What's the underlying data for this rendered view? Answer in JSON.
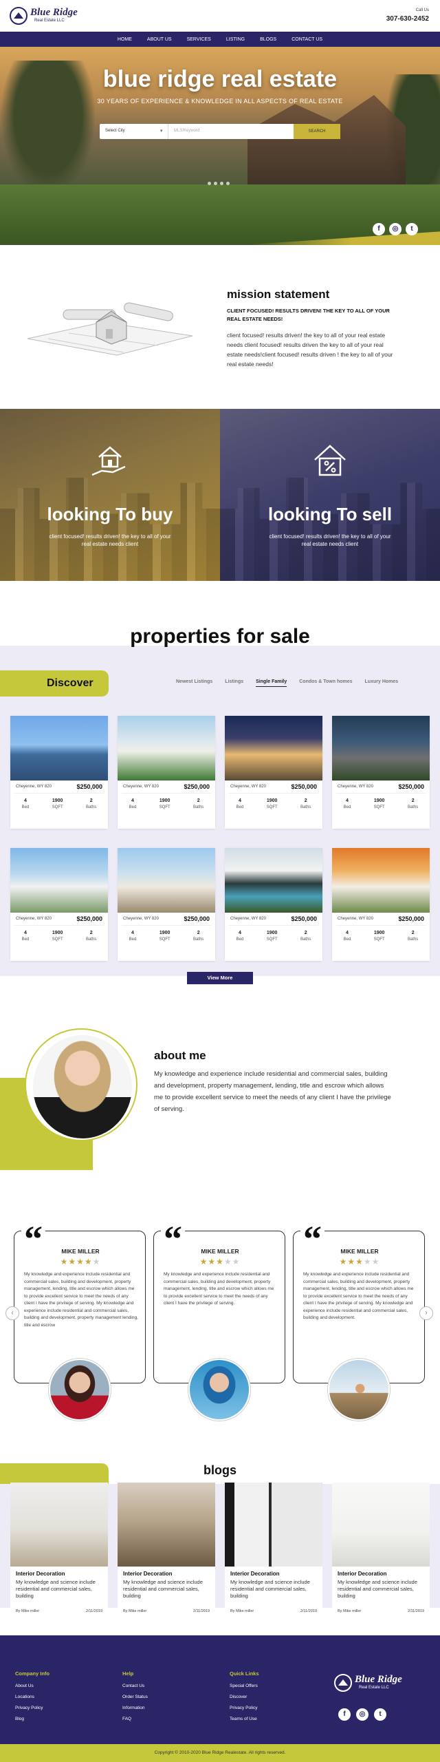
{
  "brand": {
    "name": "Blue Ridge",
    "tagline": "Real Estate LLC"
  },
  "header": {
    "call_label": "Call Us",
    "phone": "307-630-2452"
  },
  "nav": [
    "HOME",
    "ABOUT US",
    "SERVICES",
    "LISTING",
    "BLOGS",
    "CONTACT US"
  ],
  "hero": {
    "title": "blue ridge real estate",
    "subtitle": "30 YEARS OF EXPERIENCE & KNOWLEDGE IN ALL ASPECTS OF REAL ESTATE",
    "city_select": "Select City",
    "search_placeholder": "MLS/Keyword",
    "search_button": "SEARCH",
    "social": [
      "f",
      "◎",
      "t"
    ]
  },
  "mission": {
    "heading": "mission statement",
    "lead": "CLIENT FOCUSED! RESULTS DRIVEN! THE KEY TO ALL OF YOUR REAL ESTATE NEEDS!",
    "body": "client focused! results driven! the key to all of your real estate needs client focused! results driven the key to all of your real estate needs!client focused! results driven ! the key to all of your real estate needs!"
  },
  "buy": {
    "heading": "looking To buy",
    "text": "client focused! results driven! the key to all of your real estate needs client"
  },
  "sell": {
    "heading": "looking To sell",
    "text": "client focused! results driven! the key to all of your real estate needs client"
  },
  "properties": {
    "heading": "properties for sale",
    "discover": "Discover",
    "tabs": [
      "Newest Listings",
      "Listings",
      "Single Family",
      "Condos & Town homes",
      "Luxury Homes"
    ],
    "active_tab": "Single Family",
    "view_more": "View More",
    "stat_units": {
      "bed": "Bed",
      "sqft": "SQFT",
      "baths": "Baths"
    },
    "listings": [
      {
        "location": "Cheyenne, WY 820",
        "price": "$250,000",
        "bed": "4",
        "sqft": "1900",
        "baths": "2"
      },
      {
        "location": "Cheyenne, WY 820",
        "price": "$250,000",
        "bed": "4",
        "sqft": "1900",
        "baths": "2"
      },
      {
        "location": "Cheyenne, WY 820",
        "price": "$250,000",
        "bed": "4",
        "sqft": "1900",
        "baths": "2"
      },
      {
        "location": "Cheyenne, WY 820",
        "price": "$250,000",
        "bed": "4",
        "sqft": "1900",
        "baths": "2"
      },
      {
        "location": "Cheyenne, WY 820",
        "price": "$250,000",
        "bed": "4",
        "sqft": "1900",
        "baths": "2"
      },
      {
        "location": "Cheyenne, WY 820",
        "price": "$250,000",
        "bed": "4",
        "sqft": "1900",
        "baths": "2"
      },
      {
        "location": "Cheyenne, WY 820",
        "price": "$250,000",
        "bed": "4",
        "sqft": "1900",
        "baths": "2"
      },
      {
        "location": "Cheyenne, WY 820",
        "price": "$250,000",
        "bed": "4",
        "sqft": "1900",
        "baths": "2"
      }
    ]
  },
  "about": {
    "heading": "about me",
    "body": "My knowledge and experience include residential and commercial sales, building and development, property management, lending, title and escrow which allows me to provide excellent service to meet the needs of any client I have the privilege of serving."
  },
  "testimonials": [
    {
      "name": "MIKE MILLER",
      "rating": 4,
      "text": "My knowledge and experience include residential and commercial sales, building and development, property management, lending, title and escrow which allows me to provide excellent service to meet the needs of any client I have the privilege of serving. My knowledge and experience include residential and commercial sales, building and development, property management lending, title and escrow"
    },
    {
      "name": "MIKE MILLER",
      "rating": 3,
      "text": "My knowledge and experience include residential and commercial sales, building and development, property management, lending, title and escrow which allows me to provide excellent service to meet the needs of any client I have the privilege of serving."
    },
    {
      "name": "MIKE MILLER",
      "rating": 3,
      "text": "My knowledge and experience include residential and commercial sales, building and development, property management, lending, title and escrow which allows me to provide excellent service to meet the needs of any client I have the privilege of serving. My knowledge and experience include residential and commercial sales, building and development."
    }
  ],
  "blogs": {
    "heading": "blogs",
    "posts": [
      {
        "title": "Interior Decoration",
        "text": "My knowledge and science include residential and commercial sales, building",
        "author": "By Mike miller",
        "date": "2/11/2019"
      },
      {
        "title": "Interior Decoration",
        "text": "My knowledge and science include residential and commercial sales, building",
        "author": "By Mike miller",
        "date": "2/11/2019"
      },
      {
        "title": "Interior Decoration",
        "text": "My knowledge and science include residential and commercial sales, building",
        "author": "By Mike miller",
        "date": "2/11/2019"
      },
      {
        "title": "Interior Decoration",
        "text": "My knowledge and science include residential and commercial sales, building",
        "author": "By Mike miller",
        "date": "2/11/2019"
      }
    ]
  },
  "footer": {
    "columns": [
      {
        "heading": "Company Info",
        "links": [
          "About Us",
          "Locations",
          "Privacy Policy",
          "Blog"
        ]
      },
      {
        "heading": "Help",
        "links": [
          "Contact Us",
          "Order Status",
          "Information",
          "FAQ"
        ]
      },
      {
        "heading": "Quick Links",
        "links": [
          "Special Offers",
          "Discover",
          "Privacy Policy",
          "Teams of Use"
        ]
      }
    ],
    "social": [
      "f",
      "◎",
      "t"
    ],
    "copyright": "Copyright © 2010-2020 Blue Ridge Realestate. All rights reserved."
  },
  "colors": {
    "navy": "#2a2566",
    "accent": "#c6c83c",
    "lavender": "#ecebf6"
  }
}
